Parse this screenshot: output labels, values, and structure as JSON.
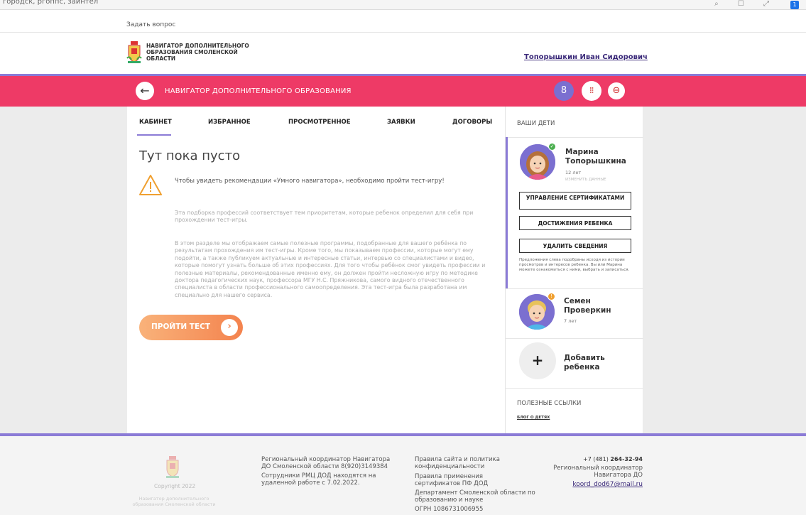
{
  "browser": {
    "url_fragment": "городск, ргоппс, заинтел",
    "ext_badge": "1"
  },
  "topbar": {
    "ask_question": "Задать вопрос"
  },
  "header": {
    "logo_line1": "Навигатор дополнительного",
    "logo_line2": "образования Смоленской",
    "logo_line3": "области",
    "user_name": "Топорышкин Иван Сидорович"
  },
  "navbar": {
    "back_icon": "←",
    "title": "НАВИГАТОР ДОПОЛНИТЕЛЬНОГО ОБРАЗОВАНИЯ",
    "user_icon": "8",
    "filter_icon": "⫶⫶",
    "exit_icon": "⊖",
    "accent": "#ee3a66",
    "purple": "#8b7bd6"
  },
  "tabs": [
    {
      "label": "КАБИНЕТ",
      "active": true
    },
    {
      "label": "ИЗБРАННОЕ"
    },
    {
      "label": "ПРОСМОТРЕННОЕ"
    },
    {
      "label": "ЗАЯВКИ"
    },
    {
      "label": "ДОГОВОРЫ"
    }
  ],
  "main": {
    "empty_title": "Тут пока пусто",
    "warning": "Чтобы увидеть рекомендации «Умного навигатора», необходимо пройти тест-игру!",
    "para1": "Эта подборка профессий соответствует тем приоритетам, которые ребенок определил для себя при прохождении тест-игры.",
    "para2": "В этом разделе мы отображаем самые полезные программы, подобранные для вашего ребёнка по результатам прохождения им тест-игры. Кроме того, мы показываем профессии, которые могут ему подойти, а также публикуем актуальные и интересные статьи, интервью со специалистами и видео, которые помогут узнать больше об этих профессиях. Для того чтобы ребёнок смог увидеть профессии и полезные материалы, рекомендованные именно ему, он должен пройти несложную игру по методике доктора педагогических наук, профессора МГУ Н.С. Пряжникова, самого видного отечественного специалиста в области профессионального самоопределения. Эта тест-игра была разработана им специально для нашего сервиса.",
    "test_button": "ПРОЙТИ ТЕСТ",
    "test_arrow": "›"
  },
  "sidebar": {
    "header": "ВАШИ ДЕТИ",
    "child1": {
      "name": "Марина Топорышкина",
      "age": "12 лет",
      "edit": "изменить данные",
      "badge": "✓",
      "btn_certs": "УПРАВЛЕНИЕ СЕРТИФИКАТАМИ",
      "btn_achievements": "ДОСТИЖЕНИЯ РЕБЕНКА",
      "btn_delete": "УДАЛИТЬ СВЕДЕНИЯ",
      "note": "Предложения слева подобраны исходя из истории просмотров и интересов ребенка. Вы или Марина можете ознакомиться с ними, выбрать и записаться."
    },
    "child2": {
      "name": "Семен Проверкин",
      "age": "7 лет",
      "badge": "!"
    },
    "add_child": {
      "plus": "+",
      "label": "Добавить ребенка"
    },
    "links_header": "ПОЛЕЗНЫЕ ССЫЛКИ",
    "links_item": "Блог о детях"
  },
  "footer": {
    "copyright": "Copyright 2022",
    "navi_caption": "Навигатор дополнительного образования Смоленской области",
    "coord_text": "Региональный координатор Навигатора ДО Смоленской области 8(920)3149384",
    "rmc_text": "Сотрудники РМЦ ДОД находятся на удаленной работе с 7.02.2022.",
    "rules_link": "Правила сайта и политика конфиденциальности",
    "certs_link": "Правила применения сертификатов ПФ ДОД",
    "dept_text": "Департамент Смоленской области по образованию и науке",
    "ogrn": "ОГРН 1086731006955",
    "phone_prefix": "+7 (481) ",
    "phone_main": "264-32-94",
    "regional_coord": "Региональный координатор Навигатора ДО",
    "email": "koord_dod67@mail.ru"
  }
}
